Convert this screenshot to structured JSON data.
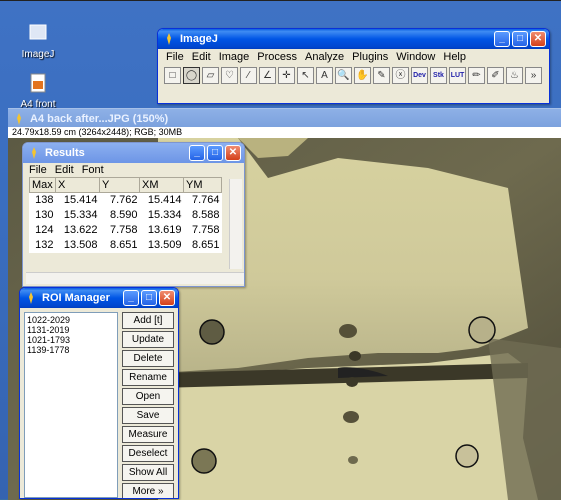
{
  "desktop": {
    "icons": [
      {
        "label": "ImageJ",
        "icon": "imagej-icon"
      },
      {
        "label": "A4 front",
        "icon": "jpg-file-icon"
      }
    ]
  },
  "imagej_window": {
    "title": "ImageJ",
    "menu": [
      "File",
      "Edit",
      "Image",
      "Process",
      "Analyze",
      "Plugins",
      "Window",
      "Help"
    ],
    "tools": [
      {
        "name": "rectangle-tool-icon",
        "glyph": "□"
      },
      {
        "name": "oval-tool-icon",
        "glyph": "◯",
        "selected": true
      },
      {
        "name": "polygon-tool-icon",
        "glyph": "▱"
      },
      {
        "name": "freehand-tool-icon",
        "glyph": "♡"
      },
      {
        "name": "straight-line-tool-icon",
        "glyph": "⁄"
      },
      {
        "name": "angle-tool-icon",
        "glyph": "∠"
      },
      {
        "name": "point-tool-icon",
        "glyph": "✛"
      },
      {
        "name": "wand-tool-icon",
        "glyph": "↖"
      },
      {
        "name": "text-tool-icon",
        "glyph": "A"
      },
      {
        "name": "magnifier-tool-icon",
        "glyph": "🔍"
      },
      {
        "name": "hand-tool-icon",
        "glyph": "✋"
      },
      {
        "name": "dropper-tool-icon",
        "glyph": "✎"
      },
      {
        "name": "x-tool-icon",
        "glyph": "ⓧ"
      },
      {
        "name": "dev-tool-icon",
        "glyph": "Dev"
      },
      {
        "name": "stk-tool-icon",
        "glyph": "Stk"
      },
      {
        "name": "lut-tool-icon",
        "glyph": "LUT"
      },
      {
        "name": "pencil-tool-icon",
        "glyph": "✏"
      },
      {
        "name": "brush-tool-icon",
        "glyph": "✐"
      },
      {
        "name": "fill-tool-icon",
        "glyph": "♨"
      },
      {
        "name": "more-tools-icon",
        "glyph": "»"
      }
    ]
  },
  "image_window": {
    "title": "A4 back after...JPG (150%)",
    "info": "24.79x18.59 cm (3264x2448); RGB; 30MB"
  },
  "results_window": {
    "title": "Results",
    "menu": [
      "File",
      "Edit",
      "Font"
    ],
    "columns": [
      "Max",
      "X",
      "Y",
      "XM",
      "YM"
    ],
    "rows": [
      [
        "138",
        "15.414",
        "7.762",
        "15.414",
        "7.764"
      ],
      [
        "130",
        "15.334",
        "8.590",
        "15.334",
        "8.588"
      ],
      [
        "124",
        "13.622",
        "7.758",
        "13.619",
        "7.758"
      ],
      [
        "132",
        "13.508",
        "8.651",
        "13.509",
        "8.651"
      ]
    ]
  },
  "roi_manager": {
    "title": "ROI Manager",
    "items": [
      "1022-2029",
      "1131-2019",
      "1021-1793",
      "1139-1778"
    ],
    "buttons": [
      "Add [t]",
      "Update",
      "Delete",
      "Rename",
      "Open",
      "Save",
      "Measure",
      "Deselect",
      "Show All",
      "More »"
    ]
  }
}
